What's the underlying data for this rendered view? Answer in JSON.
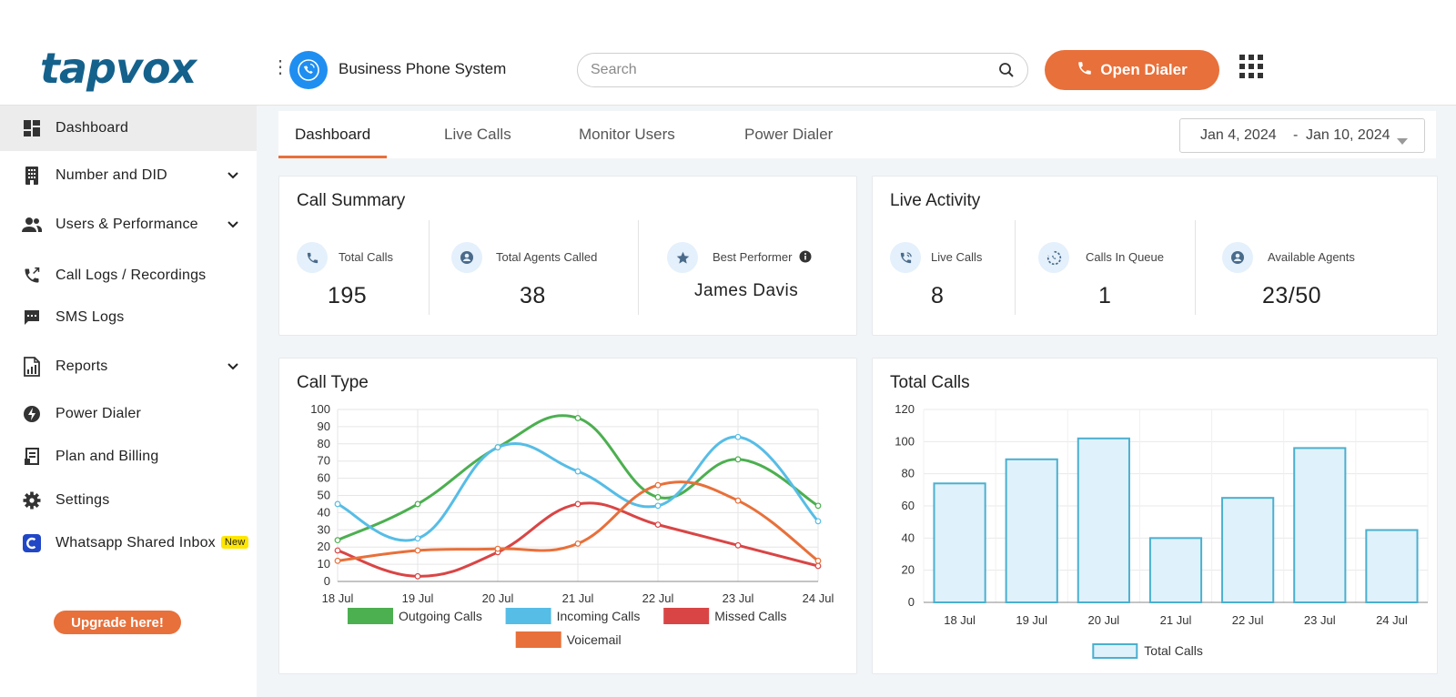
{
  "header": {
    "logo": "tapvox",
    "app_title": "Business Phone System",
    "search_placeholder": "Search",
    "open_dialer_label": "Open Dialer"
  },
  "sidebar": {
    "items": [
      {
        "label": "Dashboard",
        "icon": "dashboard-icon",
        "active": true
      },
      {
        "label": "Number and DID",
        "icon": "building-icon",
        "expandable": true
      },
      {
        "label": "Users & Performance",
        "icon": "users-icon",
        "expandable": true
      },
      {
        "label": "Call Logs / Recordings",
        "icon": "phone-log-icon"
      },
      {
        "label": "SMS Logs",
        "icon": "message-icon"
      },
      {
        "label": "Reports",
        "icon": "report-icon",
        "expandable": true
      },
      {
        "label": "Power Dialer",
        "icon": "bolt-icon"
      },
      {
        "label": "Plan and Billing",
        "icon": "billing-icon"
      },
      {
        "label": "Settings",
        "icon": "gear-icon"
      },
      {
        "label": "Whatsapp Shared Inbox",
        "icon": "whatsapp-icon",
        "badge": "New"
      }
    ],
    "upgrade_label": "Upgrade here!"
  },
  "tabs": [
    {
      "label": "Dashboard",
      "active": true
    },
    {
      "label": "Live Calls"
    },
    {
      "label": "Monitor Users"
    },
    {
      "label": "Power Dialer"
    }
  ],
  "date_range": {
    "start": "Jan 4, 2024",
    "separator": "-",
    "end": "Jan 10, 2024"
  },
  "call_summary": {
    "title": "Call Summary",
    "stats": [
      {
        "label": "Total Calls",
        "value": "195",
        "icon": "phone-icon"
      },
      {
        "label": "Total Agents Called",
        "value": "38",
        "icon": "agent-icon"
      },
      {
        "label": "Best Performer",
        "value": "James Davis",
        "icon": "star-icon"
      }
    ]
  },
  "live_activity": {
    "title": "Live Activity",
    "stats": [
      {
        "label": "Live Calls",
        "value": "8",
        "icon": "live-call-icon"
      },
      {
        "label": "Calls In Queue",
        "value": "1",
        "icon": "queue-icon"
      },
      {
        "label": "Available Agents",
        "value": "23/50",
        "icon": "agent-icon"
      }
    ]
  },
  "colors": {
    "accent": "#e8703a",
    "brand": "#14618c",
    "outgoing": "#4caf50",
    "incoming": "#56bde6",
    "missed": "#d94545",
    "voicemail": "#e8703a",
    "bar_fill": "#dff1fb",
    "bar_stroke": "#4bb0cf"
  },
  "chart_data": [
    {
      "type": "line",
      "title": "Call Type",
      "categories": [
        "18 Jul",
        "19 Jul",
        "20 Jul",
        "21 Jul",
        "22 Jul",
        "23 Jul",
        "24 Jul"
      ],
      "ylim": [
        0,
        100
      ],
      "yticks": [
        0,
        10,
        20,
        30,
        40,
        50,
        60,
        70,
        80,
        90,
        100
      ],
      "grid": true,
      "legend": "bottom",
      "series": [
        {
          "name": "Outgoing Calls",
          "values": [
            24,
            45,
            78,
            95,
            49,
            71,
            44
          ]
        },
        {
          "name": "Incoming Calls",
          "values": [
            45,
            25,
            78,
            64,
            44,
            84,
            35
          ]
        },
        {
          "name": "Missed Calls",
          "values": [
            18,
            3,
            17,
            45,
            33,
            21,
            9
          ]
        },
        {
          "name": "Voicemail",
          "values": [
            12,
            18,
            19,
            22,
            56,
            47,
            12
          ]
        }
      ]
    },
    {
      "type": "bar",
      "title": "Total Calls",
      "categories": [
        "18 Jul",
        "19 Jul",
        "20 Jul",
        "21 Jul",
        "22 Jul",
        "23 Jul",
        "24 Jul"
      ],
      "ylim": [
        0,
        120
      ],
      "yticks": [
        0,
        20,
        40,
        60,
        80,
        100,
        120
      ],
      "grid": true,
      "legend": "bottom",
      "series": [
        {
          "name": "Total Calls",
          "values": [
            74,
            89,
            102,
            40,
            65,
            96,
            45
          ]
        }
      ]
    }
  ]
}
